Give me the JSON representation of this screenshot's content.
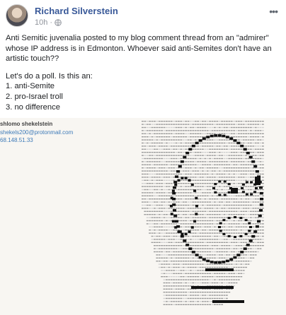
{
  "post": {
    "author": "Richard Silverstein",
    "time": "10h",
    "separator": "·",
    "paragraphs": [
      "Anti Semitic juvenalia posted to my blog comment thread from an \"admirer\" whose IP address is in Edmonton. Whoever said anti-Semites don't have an artistic touch??",
      "Let's do a poll. Is this an:"
    ],
    "poll_options": [
      "1. anti-Semite",
      "2. pro-Israel troll",
      "3. no difference"
    ]
  },
  "comment_screenshot": {
    "commenter_name": "shlomo shekelstein",
    "commenter_email": "shekels200@protonmail.com",
    "commenter_ip": "68.148.51.33"
  },
  "icons": {
    "more": "more-options-icon",
    "privacy": "globe-icon",
    "avatar": "profile-photo"
  },
  "colors": {
    "author_link": "#385898",
    "meta": "#90949c",
    "email_link": "#3d7ab8"
  }
}
